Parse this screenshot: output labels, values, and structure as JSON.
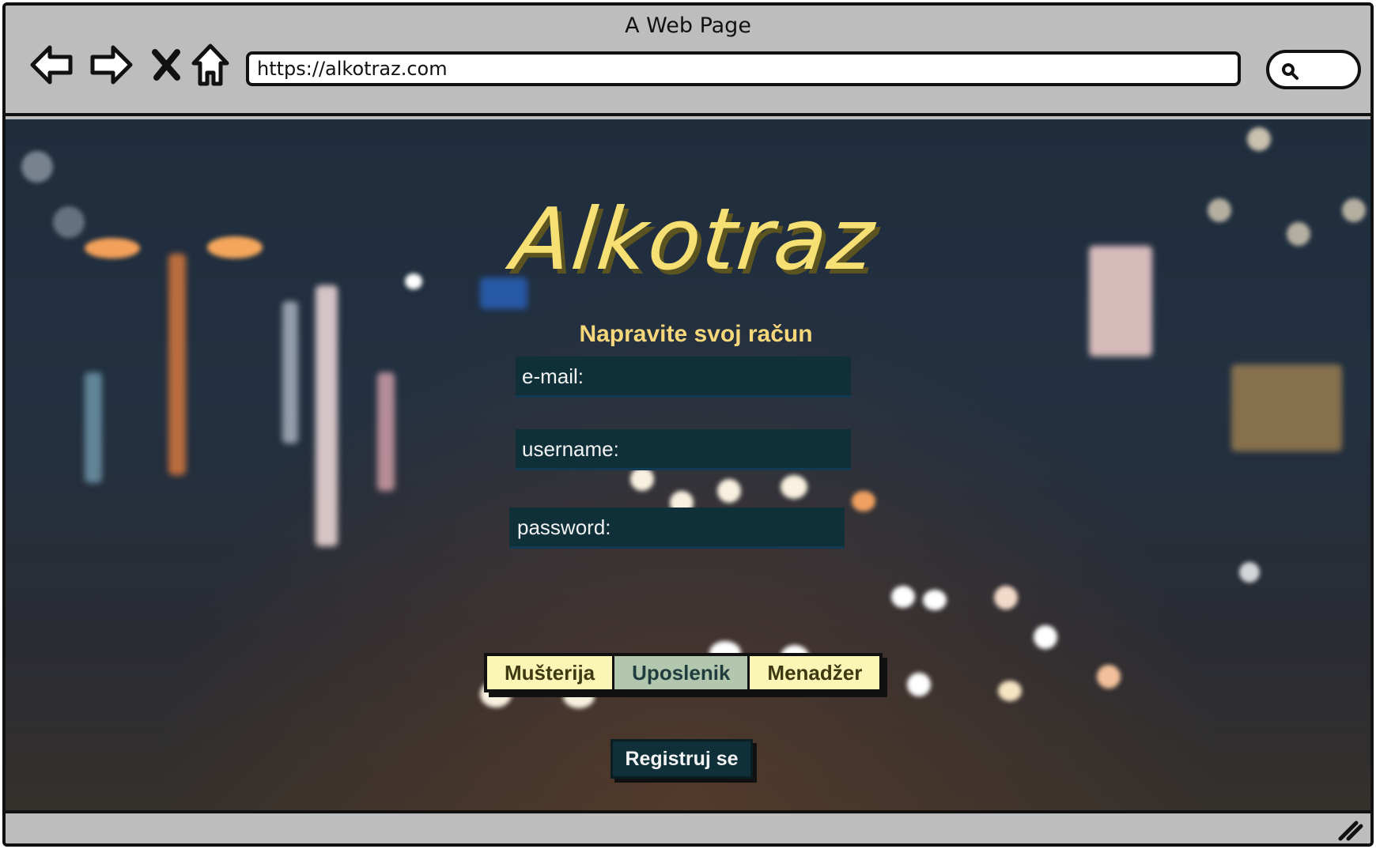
{
  "browser": {
    "title": "A Web Page",
    "url": "https://alkotraz.com",
    "icons": {
      "back": "arrow-left-icon",
      "forward": "arrow-right-icon",
      "stop": "close-icon",
      "home": "home-icon",
      "search": "search-icon",
      "resize": "resize-grip-icon"
    }
  },
  "page": {
    "logo": "Alkotraz",
    "subtitle": "Napravite svoj račun",
    "fields": {
      "email_label": "e-mail:",
      "username_label": "username:",
      "password_label": "password:"
    },
    "roles": [
      "Mušterija",
      "Uposlenik",
      "Menadžer"
    ],
    "selected_role": "Uposlenik",
    "register_label": "Registruj se"
  },
  "colors": {
    "logo": "#f6e073",
    "subtitle": "#f6d77a",
    "field_bg": "#0f3038",
    "role_bg": "#fbf5b6",
    "role_active_bg": "#b3c7ae",
    "chrome": "#bdbdbd"
  }
}
